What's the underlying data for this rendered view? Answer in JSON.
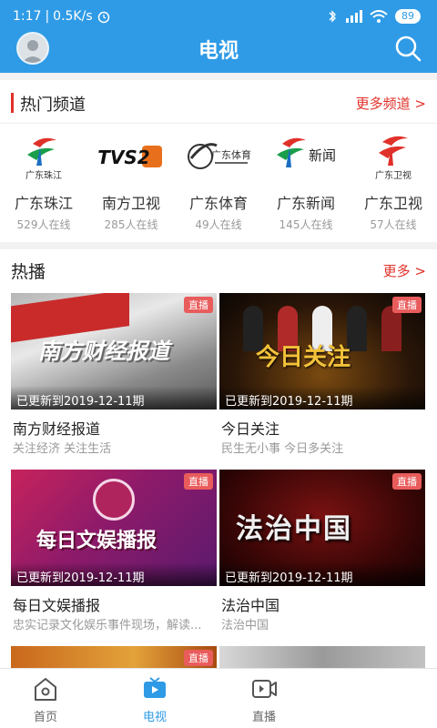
{
  "status": {
    "time": "1:17",
    "speed": "0.5K/s",
    "battery": "89"
  },
  "header": {
    "title": "电视"
  },
  "hot_channels": {
    "title": "热门频道",
    "more": "更多频道 >",
    "items": [
      {
        "name": "广东珠江",
        "count": "529人在线",
        "logo_text": "广东珠江"
      },
      {
        "name": "南方卫视",
        "count": "285人在线",
        "logo_text": "TVS2"
      },
      {
        "name": "广东体育",
        "count": "49人在线",
        "logo_text": "广东体育"
      },
      {
        "name": "广东新闻",
        "count": "145人在线",
        "logo_text": "新闻"
      },
      {
        "name": "广东卫视",
        "count": "57人在线",
        "logo_text": "广东卫视"
      }
    ]
  },
  "hot_play": {
    "title": "热播",
    "more": "更多 >",
    "items": [
      {
        "name": "南方财经报道",
        "desc": "关注经济 关注生活",
        "badge": "直播",
        "update": "已更新到2019-12-11期",
        "thumb_text": "南方财经报道"
      },
      {
        "name": "今日关注",
        "desc": "民生无小事 今日多关注",
        "badge": "直播",
        "update": "已更新到2019-12-11期",
        "thumb_text": "今日关注"
      },
      {
        "name": "每日文娱播报",
        "desc": "忠实记录文化娱乐事件现场，解读...",
        "badge": "直播",
        "update": "已更新到2019-12-11期",
        "thumb_text": "每日文娱播报"
      },
      {
        "name": "法治中国",
        "desc": "法治中国",
        "badge": "直播",
        "update": "已更新到2019-12-11期",
        "thumb_text": "法治中国"
      },
      {
        "badge": "直播"
      },
      {
        "badge": ""
      }
    ]
  },
  "bottom_nav": {
    "items": [
      {
        "label": "首页",
        "icon": "home-icon"
      },
      {
        "label": "电视",
        "icon": "tv-icon"
      },
      {
        "label": "直播",
        "icon": "live-video-icon"
      }
    ]
  },
  "colors": {
    "primary": "#2f9be6",
    "accent": "#e0312a"
  }
}
